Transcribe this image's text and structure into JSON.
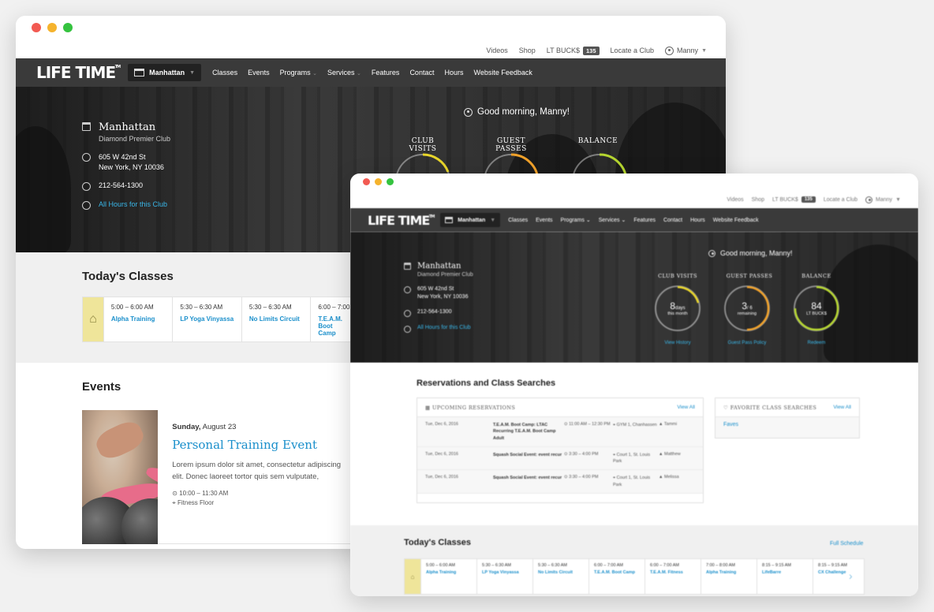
{
  "colors": {
    "accent_blue": "#1a8fcb",
    "nav_bg": "#3a3a3a",
    "today_yellow": "#efe59a",
    "ring_yellow": "#e8d52a",
    "ring_orange": "#f0a12a",
    "ring_green": "#b5d530"
  },
  "utility": {
    "videos": "Videos",
    "shop": "Shop",
    "lt_bucks": "LT BUCK$",
    "lt_bucks_count": "135",
    "locate": "Locate a Club",
    "user": "Manny"
  },
  "nav": {
    "logo": "LIFE TIME",
    "club": "Manhattan",
    "links": [
      "Classes",
      "Events",
      "Programs",
      "Services",
      "Features",
      "Contact",
      "Hours",
      "Website Feedback"
    ]
  },
  "hero": {
    "club_name": "Manhattan",
    "club_type": "Diamond Premier Club",
    "address_line1": "605 W 42nd St",
    "address_line2": "New York, NY 10036",
    "phone": "212-564-1300",
    "hours_link": "All Hours for this Club",
    "greeting": "Good morning, Manny!",
    "stats": [
      {
        "label": "CLUB VISITS",
        "value": "8",
        "unit": "days",
        "sub": "this month",
        "link": "View History",
        "progress": 0.3
      },
      {
        "label": "GUEST PASSES",
        "value": "3",
        "unit": "/ 6",
        "sub": "remaining",
        "link": "Guest Pass Policy",
        "progress": 0.5
      },
      {
        "label": "BALANCE",
        "value": "84",
        "unit": "",
        "sub": "LT BUCK$",
        "link": "Redeem",
        "progress": 0.75
      }
    ],
    "partial_stat_values": [
      "8",
      "3",
      "84"
    ]
  },
  "today_classes": {
    "title": "Today's Classes",
    "full_schedule": "Full Schedule",
    "classes": [
      {
        "time": "5:00 – 6:00 AM",
        "name": "Alpha Training"
      },
      {
        "time": "5:30 – 6:30 AM",
        "name": "LP Yoga Vinyassa"
      },
      {
        "time": "5:30 – 6:30 AM",
        "name": "No Limits Circuit"
      },
      {
        "time": "6:00 – 7:00 AM",
        "name": "T.E.A.M. Boot Camp"
      },
      {
        "time": "6:00 – 7:00 AM",
        "name": "T.E.A.M. Fitness"
      },
      {
        "time": "7:00 – 8:00 AM",
        "name": "Alpha Training"
      },
      {
        "time": "8:15 – 9:15 AM",
        "name": "LifeBarre"
      },
      {
        "time": "8:15 – 9:15 AM",
        "name": "CX Challenge"
      }
    ]
  },
  "events": {
    "title": "Events",
    "event": {
      "day": "Sunday,",
      "date": "August 23",
      "title": "Personal Training Event",
      "desc": "Lorem ipsum dolor sit amet, consectetur adipiscing elit. Donec laoreet tortor quis sem vulputate,",
      "time": "10:00 – 11:30 AM",
      "location": "Fitness Floor"
    }
  },
  "reservations": {
    "title": "Reservations and Class Searches",
    "upcoming_label": "UPCOMING RESERVATIONS",
    "view_all": "View All",
    "rows": [
      {
        "date": "Tue, Dec 6, 2016",
        "name": "T.E.A.M. Boot Camp: LTAC Recurring T.E.A.M. Boot Camp Adult",
        "time": "11:00 AM – 12:30 PM",
        "loc": "GYM 1, Chanhassen",
        "who": "Tammi"
      },
      {
        "date": "Tue, Dec 6, 2016",
        "name": "Squash Social Event: event recur",
        "time": "3:30 – 4:00 PM",
        "loc": "Court 1, St. Louis Park",
        "who": "Matthew"
      },
      {
        "date": "Tue, Dec 6, 2016",
        "name": "Squash Social Event: event recur",
        "time": "3:30 – 4:00 PM",
        "loc": "Court 1, St. Louis Park",
        "who": "Melissa"
      }
    ],
    "fav_label": "FAVORITE CLASS SEARCHES",
    "fav_view_all": "View All",
    "fav_item": "Faves"
  }
}
